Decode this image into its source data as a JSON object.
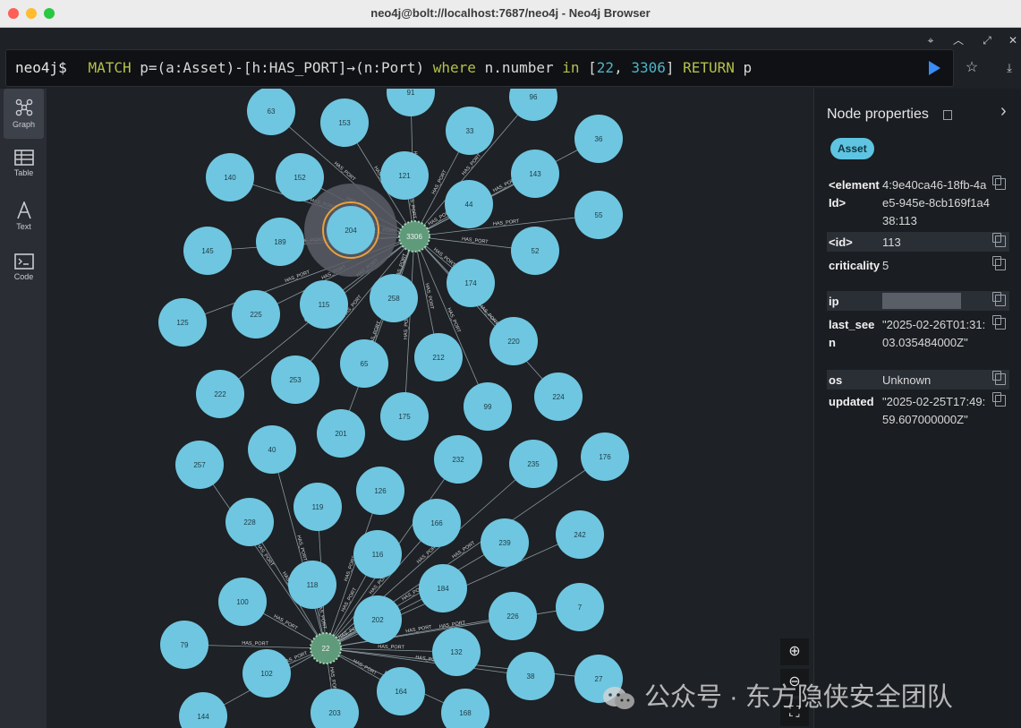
{
  "window": {
    "title": "neo4j@bolt://localhost:7687/neo4j - Neo4j Browser"
  },
  "editor": {
    "prompt": "neo4j$",
    "query_tokens": [
      {
        "t": "MATCH",
        "c": "kw"
      },
      {
        "t": " p=(a:Asset)-[h:HAS_PORT]→(n:Port) ",
        "c": "pl"
      },
      {
        "t": "where",
        "c": "kw"
      },
      {
        "t": " n.number ",
        "c": "pl"
      },
      {
        "t": "in",
        "c": "kw"
      },
      {
        "t": " [",
        "c": "pl"
      },
      {
        "t": "22",
        "c": "num"
      },
      {
        "t": ", ",
        "c": "pl"
      },
      {
        "t": "3306",
        "c": "num"
      },
      {
        "t": "] ",
        "c": "pl"
      },
      {
        "t": "RETURN",
        "c": "kw"
      },
      {
        "t": " p",
        "c": "pl"
      }
    ]
  },
  "sidebar": {
    "items": [
      {
        "label": "Graph",
        "icon": "graph-icon",
        "active": true
      },
      {
        "label": "Table",
        "icon": "table-icon",
        "active": false
      },
      {
        "label": "Text",
        "icon": "text-icon",
        "active": false
      },
      {
        "label": "Code",
        "icon": "code-icon",
        "active": false
      }
    ]
  },
  "graph": {
    "rel_label": "HAS_PORT",
    "colors": {
      "asset": "#6fc6e0",
      "port": "#5f9a7a",
      "bg": "#1e2125"
    },
    "port_nodes": [
      "3306",
      "22"
    ],
    "asset_nodes": [
      "63",
      "153",
      "91",
      "96",
      "33",
      "36",
      "140",
      "152",
      "121",
      "143",
      "44",
      "55",
      "145",
      "189",
      "204",
      "52",
      "125",
      "225",
      "115",
      "258",
      "174",
      "222",
      "253",
      "65",
      "212",
      "220",
      "224",
      "201",
      "175",
      "99",
      "257",
      "40",
      "232",
      "235",
      "176",
      "126",
      "228",
      "119",
      "166",
      "239",
      "242",
      "116",
      "118",
      "184",
      "100",
      "202",
      "226",
      "7",
      "79",
      "132",
      "102",
      "164",
      "38",
      "27",
      "144",
      "203",
      "168"
    ]
  },
  "properties": {
    "title": "Node properties",
    "label_pill": "Asset",
    "rows": [
      {
        "key": "<elementId>",
        "value": "4:9e40ca46-18fb-4ae5-945e-8cb169f1a438:113"
      },
      {
        "key": "<id>",
        "value": "113"
      },
      {
        "key": "criticality",
        "value": "5"
      },
      {
        "key": "ip",
        "value": "",
        "masked": true
      },
      {
        "key": "last_seen",
        "value": "\"2025-02-26T01:31:03.035484000Z\""
      },
      {
        "key": "os",
        "value": "Unknown"
      },
      {
        "key": "updated",
        "value": "\"2025-02-25T17:49:59.607000000Z\""
      }
    ]
  },
  "watermark": "公众号 · 东方隐侠安全团队"
}
